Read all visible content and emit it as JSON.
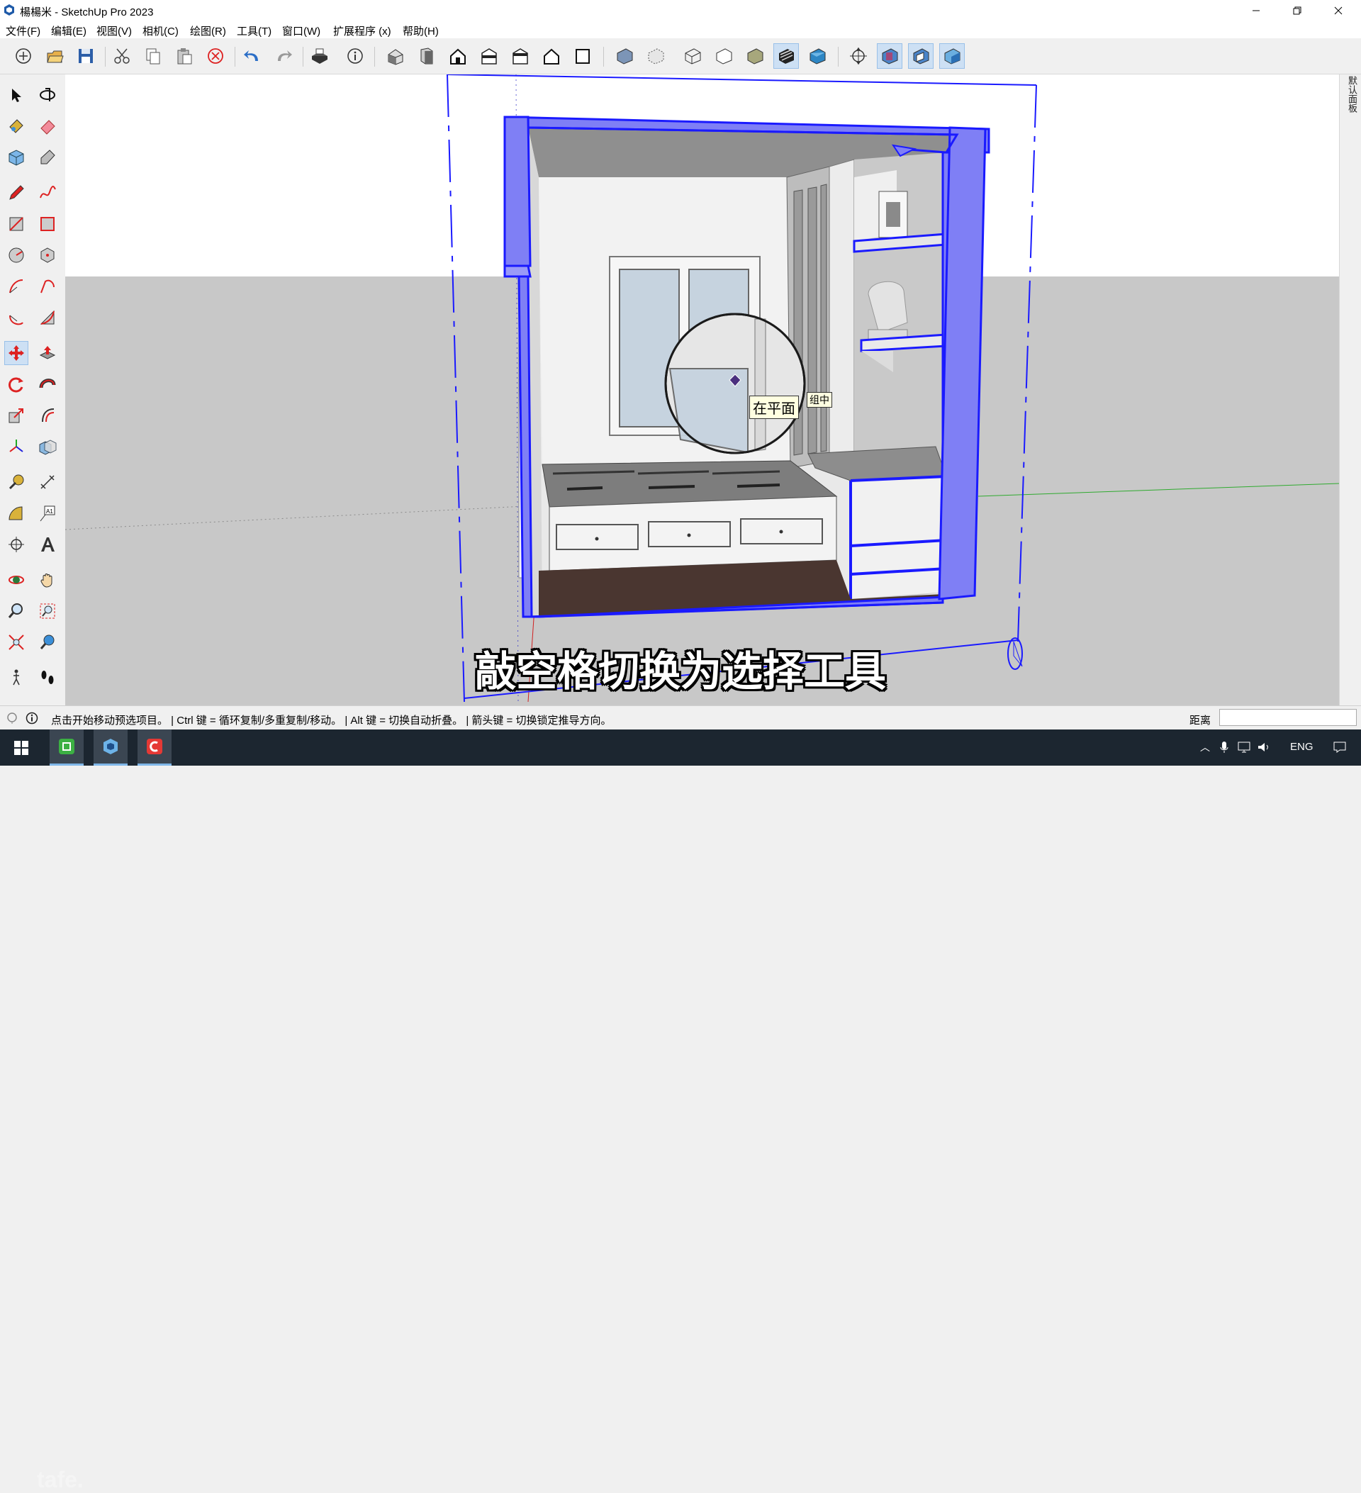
{
  "window": {
    "title": "楊楊米 - SketchUp Pro 2023"
  },
  "menu": [
    "文件(F)",
    "编辑(E)",
    "视图(V)",
    "相机(C)",
    "绘图(R)",
    "工具(T)",
    "窗口(W)",
    "扩展程序 (x)",
    "帮助(H)"
  ],
  "toolbar": {
    "icons": [
      "new-icon",
      "open-icon",
      "save-icon",
      "cut-icon",
      "copy-icon",
      "paste-icon",
      "erase-icon",
      "undo-icon",
      "redo-icon",
      "print-icon",
      "model-info-icon",
      "iso-view-icon",
      "top-view-icon",
      "front-view-icon",
      "right-view-icon",
      "back-view-icon",
      "left-view-icon",
      "bottom-view-icon",
      "xray-icon",
      "back-edges-icon",
      "wireframe-icon",
      "hidden-line-icon",
      "shaded-icon",
      "shaded-textures-icon",
      "monochrome-icon",
      "section-plane-icon",
      "display-section-planes-icon",
      "display-section-cuts-icon",
      "display-section-fill-icon"
    ]
  },
  "tools": [
    "select-tool",
    "orbit-tool",
    "paint-tool",
    "eraser-tool",
    "component-tool",
    "tag-tool",
    "pencil-tool",
    "freehand-tool",
    "rectangle-tool",
    "rotated-rectangle-tool",
    "circle-tool",
    "polygon-tool",
    "arc-tool",
    "two-point-arc-tool",
    "three-point-arc-tool",
    "pie-tool",
    "move-tool",
    "push-pull-tool",
    "rotate-tool",
    "follow-me-tool",
    "scale-tool",
    "offset-tool",
    "axes-tool",
    "solid-tools",
    "tape-measure-tool",
    "dimension-tool",
    "protractor-tool",
    "text-tool",
    "position-camera-tool",
    "3d-text-tool",
    "orbit-view-tool",
    "pan-tool",
    "zoom-tool",
    "zoom-window-tool",
    "zoom-extents-tool",
    "previous-view-tool",
    "walk-tool",
    "footprints-tool"
  ],
  "tray": {
    "label": "默认面板"
  },
  "viewport": {
    "tooltip": "在平面",
    "tooltip_tail": "组中",
    "subtitle": "敲空格切换为选择工具"
  },
  "status": {
    "text": "点击开始移动预选项目。 | Ctrl 键 = 循环复制/多重复制/移动。 | Alt 键 = 切换自动折叠。 | 箭头键 = 切换锁定推导方向。",
    "measure_label": "距离",
    "measure_value": ""
  },
  "taskbar": {
    "lang": "ENG",
    "watermark": "tafe."
  },
  "colors": {
    "selection": "#1a1aff",
    "selection_fill": "#7f7ff5",
    "sky": "#ffffff",
    "ground": "#c8c8c8",
    "floor": "#4a3630"
  }
}
